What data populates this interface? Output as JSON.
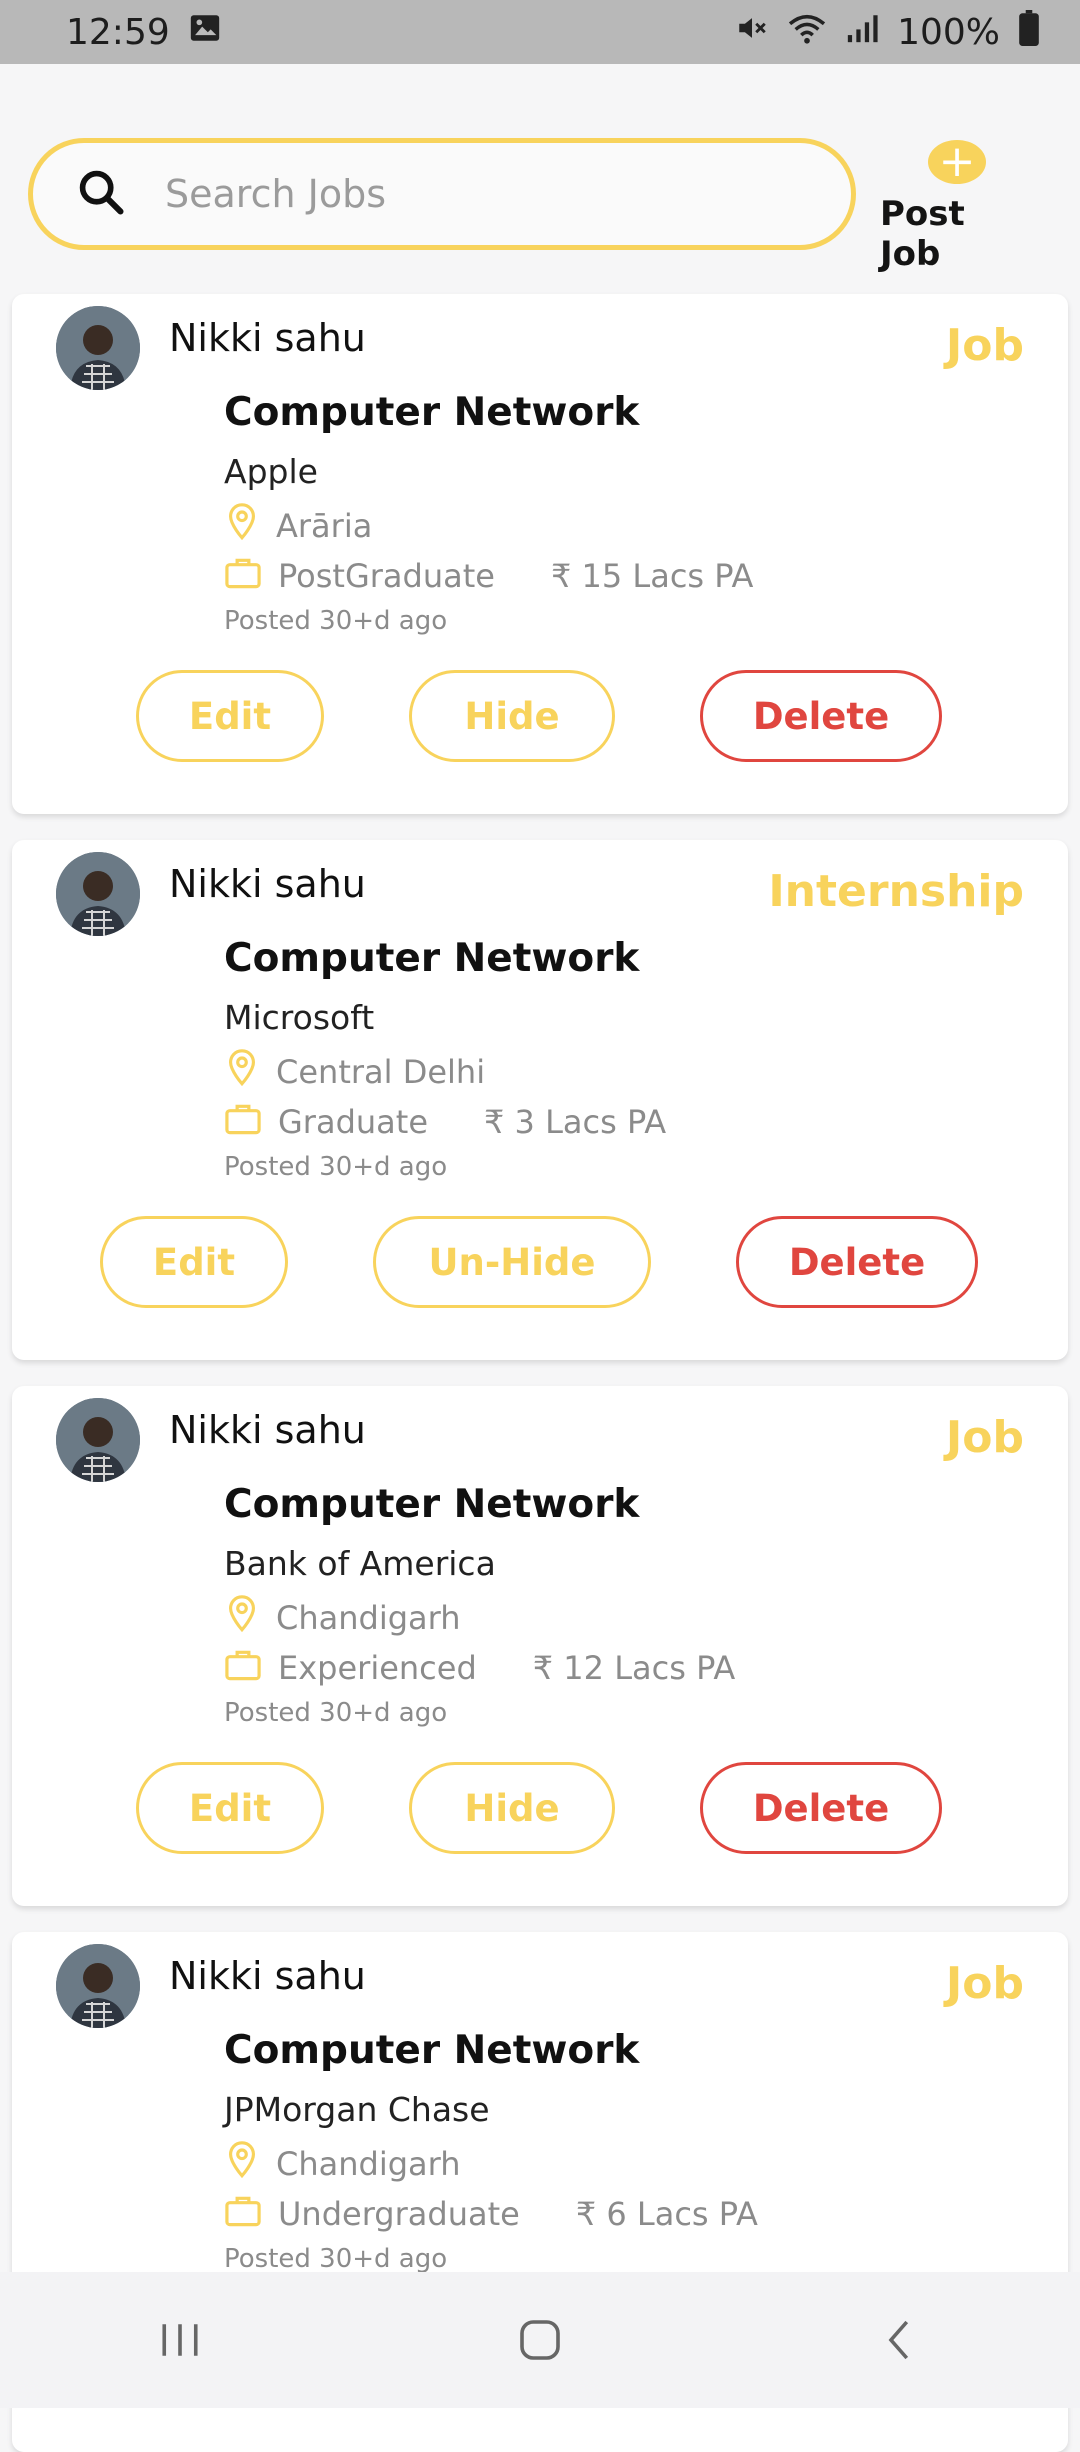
{
  "status_bar": {
    "time": "12:59",
    "battery": "100%"
  },
  "search": {
    "placeholder": "Search Jobs"
  },
  "post_job": {
    "label": "Post Job"
  },
  "jobs": [
    {
      "user": "Nikki sahu",
      "type": "Job",
      "title": "Computer Network",
      "company": "Apple",
      "location": "Arāria",
      "education": "PostGraduate",
      "salary": "₹ 15 Lacs PA",
      "posted": "Posted 30+d ago",
      "edit_label": "Edit",
      "hide_label": "Hide",
      "delete_label": "Delete"
    },
    {
      "user": "Nikki sahu",
      "type": "Internship",
      "title": "Computer Network",
      "company": "Microsoft",
      "location": "Central Delhi",
      "education": "Graduate",
      "salary": "₹ 3 Lacs PA",
      "posted": "Posted 30+d ago",
      "edit_label": "Edit",
      "hide_label": "Un-Hide",
      "delete_label": "Delete"
    },
    {
      "user": "Nikki sahu",
      "type": "Job",
      "title": "Computer Network",
      "company": "Bank of America",
      "location": "Chandigarh",
      "education": "Experienced",
      "salary": "₹ 12 Lacs PA",
      "posted": "Posted 30+d ago",
      "edit_label": "Edit",
      "hide_label": "Hide",
      "delete_label": "Delete"
    },
    {
      "user": "Nikki sahu",
      "type": "Job",
      "title": "Computer Network",
      "company": "JPMorgan Chase",
      "location": "Chandigarh",
      "education": "Undergraduate",
      "salary": "₹ 6 Lacs PA",
      "posted": "Posted 30+d ago"
    }
  ]
}
